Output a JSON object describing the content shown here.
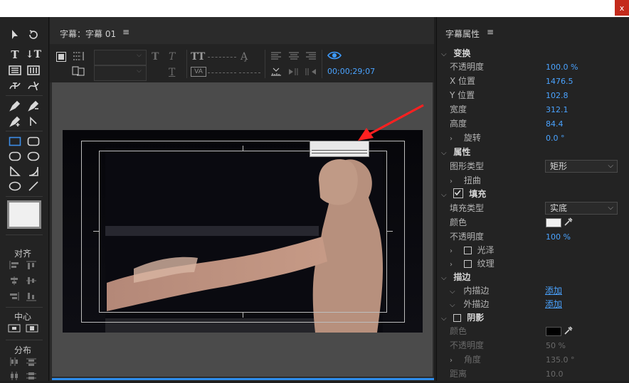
{
  "window": {
    "close_label": "x"
  },
  "tools_panel": {
    "align_label": "对齐",
    "center_label": "中心",
    "distribute_label": "分布"
  },
  "title_panel": {
    "title": "字幕：字幕 01",
    "menu_glyph": "≡",
    "timecode": "00;00;29;07"
  },
  "properties_panel": {
    "title": "字幕属性",
    "menu_glyph": "≡",
    "transform": {
      "header": "变换",
      "opacity_label": "不透明度",
      "opacity_value": "100.0 %",
      "x_label": "X 位置",
      "x_value": "1476.5",
      "y_label": "Y 位置",
      "y_value": "102.8",
      "width_label": "宽度",
      "width_value": "312.1",
      "height_label": "高度",
      "height_value": "84.4",
      "rotation_label": "旋转",
      "rotation_value": "0.0 °"
    },
    "attributes": {
      "header": "属性",
      "shape_type_label": "图形类型",
      "shape_type_value": "矩形",
      "distort_label": "扭曲"
    },
    "fill": {
      "header": "填充",
      "fill_type_label": "填充类型",
      "fill_type_value": "实底",
      "color_label": "颜色",
      "color_value": "#f0f0f0",
      "opacity_label": "不透明度",
      "opacity_value": "100 %",
      "sheen_label": "光泽",
      "texture_label": "纹理"
    },
    "stroke": {
      "header": "描边",
      "inner_label": "内描边",
      "inner_action": "添加",
      "outer_label": "外描边",
      "outer_action": "添加"
    },
    "shadow": {
      "header": "阴影",
      "color_label": "颜色",
      "color_value": "#000000",
      "opacity_label": "不透明度",
      "opacity_value": "50 %",
      "angle_label": "角度",
      "angle_value": "135.0 °",
      "distance_label": "距离",
      "distance_value": "10.0"
    }
  },
  "colors": {
    "accent": "#4aa3ff",
    "arrow": "#ff2020",
    "close": "#c42b1c"
  }
}
